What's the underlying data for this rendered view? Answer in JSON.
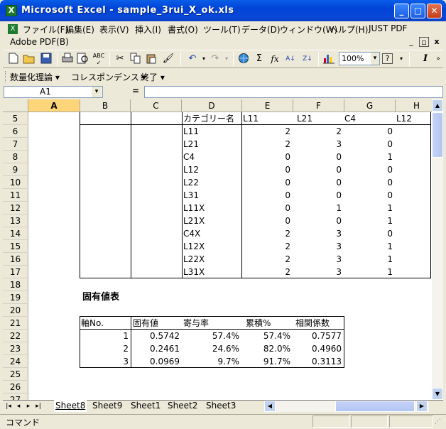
{
  "window": {
    "title": "Microsoft Excel - sample_3rui_X_ok.xls",
    "app_icon": "X",
    "minimize_glyph": "_",
    "maximize_glyph": "□",
    "close_glyph": "✕"
  },
  "menu": {
    "items": [
      "ファイル(F)",
      "編集(E)",
      "表示(V)",
      "挿入(I)",
      "書式(O)",
      "ツール(T)",
      "データ(D)",
      "ウィンドウ(W)",
      "ヘルプ(H)",
      "JUST PDF"
    ],
    "adobe": "Adobe PDF(B)",
    "help_box": "?",
    "doc_min": "_",
    "doc_restore": "▫",
    "doc_close": "x"
  },
  "toolbar": {
    "zoom": "100%",
    "zoom_arrow": "▾",
    "sigma": "Σ",
    "fx": "fx",
    "az": "A↓",
    "za": "Z↓",
    "italic": "I"
  },
  "toolbar2": {
    "items": [
      "数量化理論 ▾",
      "コレスポンデンス ▾",
      "終了 ▾"
    ]
  },
  "formula": {
    "namebox": "A1",
    "arrow": "▾",
    "equals": "="
  },
  "columns": [
    "A",
    "B",
    "C",
    "D",
    "E",
    "F",
    "G",
    "H"
  ],
  "rows": [
    "5",
    "6",
    "7",
    "8",
    "9",
    "10",
    "11",
    "12",
    "13",
    "14",
    "15",
    "16",
    "17",
    "18",
    "19",
    "20",
    "21",
    "22",
    "23",
    "24",
    "25",
    "26",
    "27"
  ],
  "cross_table": {
    "header_label": "カテゴリー名",
    "col_headers": [
      "L11",
      "L21",
      "C4",
      "L12"
    ],
    "rows": [
      {
        "name": "L11",
        "values": [
          "2",
          "2",
          "0"
        ]
      },
      {
        "name": "L21",
        "values": [
          "2",
          "3",
          "0"
        ]
      },
      {
        "name": "C4",
        "values": [
          "0",
          "0",
          "1"
        ]
      },
      {
        "name": "L12",
        "values": [
          "0",
          "0",
          "0"
        ]
      },
      {
        "name": "L22",
        "values": [
          "0",
          "0",
          "0"
        ]
      },
      {
        "name": "L31",
        "values": [
          "0",
          "0",
          "0"
        ]
      },
      {
        "name": "L11X",
        "values": [
          "0",
          "1",
          "1"
        ]
      },
      {
        "name": "L21X",
        "values": [
          "0",
          "0",
          "1"
        ]
      },
      {
        "name": "C4X",
        "values": [
          "2",
          "3",
          "0"
        ]
      },
      {
        "name": "L12X",
        "values": [
          "2",
          "3",
          "1"
        ]
      },
      {
        "name": "L22X",
        "values": [
          "2",
          "3",
          "1"
        ]
      },
      {
        "name": "L31X",
        "values": [
          "2",
          "3",
          "1"
        ]
      }
    ]
  },
  "eigen_table": {
    "title": "固有値表",
    "headers": [
      "軸No.",
      "固有値",
      "寄与率",
      "累積%",
      "相関係数"
    ],
    "rows": [
      {
        "axis": "1",
        "eigen": "0.5742",
        "contrib": "57.4%",
        "cumul": "57.4%",
        "corr": "0.7577"
      },
      {
        "axis": "2",
        "eigen": "0.2461",
        "contrib": "24.6%",
        "cumul": "82.0%",
        "corr": "0.4960"
      },
      {
        "axis": "3",
        "eigen": "0.0969",
        "contrib": "9.7%",
        "cumul": "91.7%",
        "corr": "0.3113"
      }
    ]
  },
  "sheets": {
    "tabs": [
      "Sheet8",
      "Sheet9",
      "Sheet1",
      "Sheet2",
      "Sheet3"
    ],
    "active": "Sheet8",
    "nav": [
      "|◂",
      "◂",
      "▸",
      "▸|"
    ]
  },
  "scroll": {
    "up": "▲",
    "down": "▼",
    "left": "◀",
    "right": "▶"
  },
  "status": {
    "mode": "コマンド"
  }
}
